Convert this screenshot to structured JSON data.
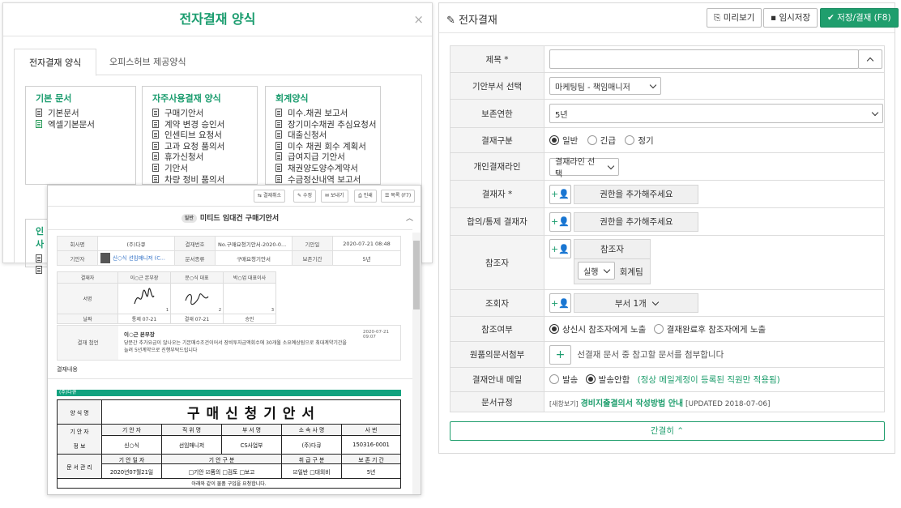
{
  "modal": {
    "title": "전자결재 양식",
    "close": "×",
    "tabs": [
      "전자결재 양식",
      "오피스허브 제공양식"
    ],
    "sections": [
      {
        "title": "기본 문서",
        "items": [
          "기본문서",
          "엑셀기본문서"
        ]
      },
      {
        "title": "자주사용결재 양식",
        "items": [
          "구매기안서",
          "계약 변경 승인서",
          "인센티브 요청서",
          "고과 요청 품의서",
          "휴가신청서",
          "기안서",
          "차량 정비 품의서"
        ]
      },
      {
        "title": "회계양식",
        "items": [
          "미수.채권 보고서",
          "장기미수채권 추심요청서",
          "대출신청서",
          "미수 채권 회수 계획서",
          "급여지급 기안서",
          "채권양도양수계약서",
          "수금정산내역 보고서"
        ]
      }
    ],
    "partial_section_title": "인사"
  },
  "preview": {
    "toolbar": [
      "결재취소",
      "수정",
      "보내기",
      "인쇄",
      "목록 (F7)"
    ],
    "badge": "일반",
    "title": "미티드 임대건 구매기안서",
    "info": {
      "r1": [
        "회사명",
        "(주)다큐",
        "결재번호",
        "No.구매요청기안서-2020-0...",
        "기안일",
        "2020-07-21 08:48"
      ],
      "r2": [
        "기안자",
        "신○식 선임매니저 (C...",
        "문서종류",
        "구매요청기안서",
        "보존기간",
        "5년"
      ]
    },
    "sign": {
      "labels": [
        "결재자",
        "서명",
        "날짜"
      ],
      "approvers": [
        "이○근 본부장",
        "문○식 대표",
        "박○업 대표이사"
      ],
      "dates": [
        "통제 07-21",
        "결재 07-21",
        "승인"
      ],
      "nums": [
        "1",
        "2",
        "3"
      ]
    },
    "opinion_label": "결재 첨언",
    "opinion_name": "이○근 본부장",
    "opinion_date": "2020-07-21 09:07",
    "opinion_text_1": "당분간 추가요금이 않나오는 기본매수조건이어서 장비투자금액회수에 30개월 소요예상됨으로 최대계약기간을",
    "opinion_text_2": "늘려 5년계약으로 진행부탁드립니다",
    "content_label": "결재내용",
    "company_tag": "(주)다큐",
    "doc": {
      "form_label": "양 식 명",
      "form_title": "구 매 신 청 기 안 서",
      "drafter_label": "기 안 자",
      "info_label": "정 보",
      "headers": [
        "기 안 자",
        "직 위 명",
        "부 서 명",
        "소 속 사 명",
        "사 번"
      ],
      "values": [
        "신○식",
        "선임매니저",
        "CS사업부",
        "(주)다큐",
        "150316-0001"
      ],
      "mgmt_label": "문 서 관 리",
      "mgmt_headers": [
        "기 안 일 자",
        "기 안 구 분",
        "취 급 구 분",
        "보 존 기 간"
      ],
      "mgmt_values": [
        "2020년07월21일",
        "□기안 ☑품의 □검토 □보고",
        "☑일반 □대외비",
        "5년"
      ],
      "footer": "아래와 같이 물품 구입을 요청합니다."
    }
  },
  "panel": {
    "title": "전자결재",
    "buttons": [
      "미리보기",
      "임시저장",
      "저장/결재 (F8)"
    ],
    "rows": {
      "subject_label": "제목",
      "required": "*",
      "dept_label": "기안부서 선택",
      "dept_value": "마케팅팀 - 책임매니저",
      "retention_label": "보존연한",
      "retention_value": "5년",
      "type_label": "결재구분",
      "type_options": [
        "일반",
        "긴급",
        "정기"
      ],
      "line_label": "개인결재라인",
      "line_value": "결재라인 선택",
      "approver_label": "결재자",
      "approver_placeholder": "권한을 추가해주세요",
      "agree_label": "합의/통제 결재자",
      "agree_placeholder": "권한을 추가해주세요",
      "ref_label": "참조자",
      "ref_box_title": "참조자",
      "ref_select": "실행",
      "ref_team": "회계팀",
      "viewer_label": "조회자",
      "viewer_value": "부서 1개",
      "ref_flag_label": "참조여부",
      "ref_flag_options": [
        "상신시 참조자에게 노출",
        "결재완료후 참조자에게 노출"
      ],
      "attach_label": "원품의문서첨부",
      "attach_text": "선결재 문서 중 참고할 문서를 첨부합니다",
      "mail_label": "결재안내 메일",
      "mail_options": [
        "발송",
        "발송안함"
      ],
      "mail_note": "(정상 메일계정이 등록된 직원만 적용됨)",
      "rule_label": "문서규정",
      "rule_prefix": "[새창보기]",
      "rule_link": "경비지출결의서 작성방법 안내",
      "rule_updated": "[UPDATED 2018-07-06]"
    },
    "collapse_label": "간결히"
  },
  "colors": {
    "accent": "#1f9e6d",
    "border": "#dcdcdc",
    "label_bg": "#f4f4f4"
  }
}
